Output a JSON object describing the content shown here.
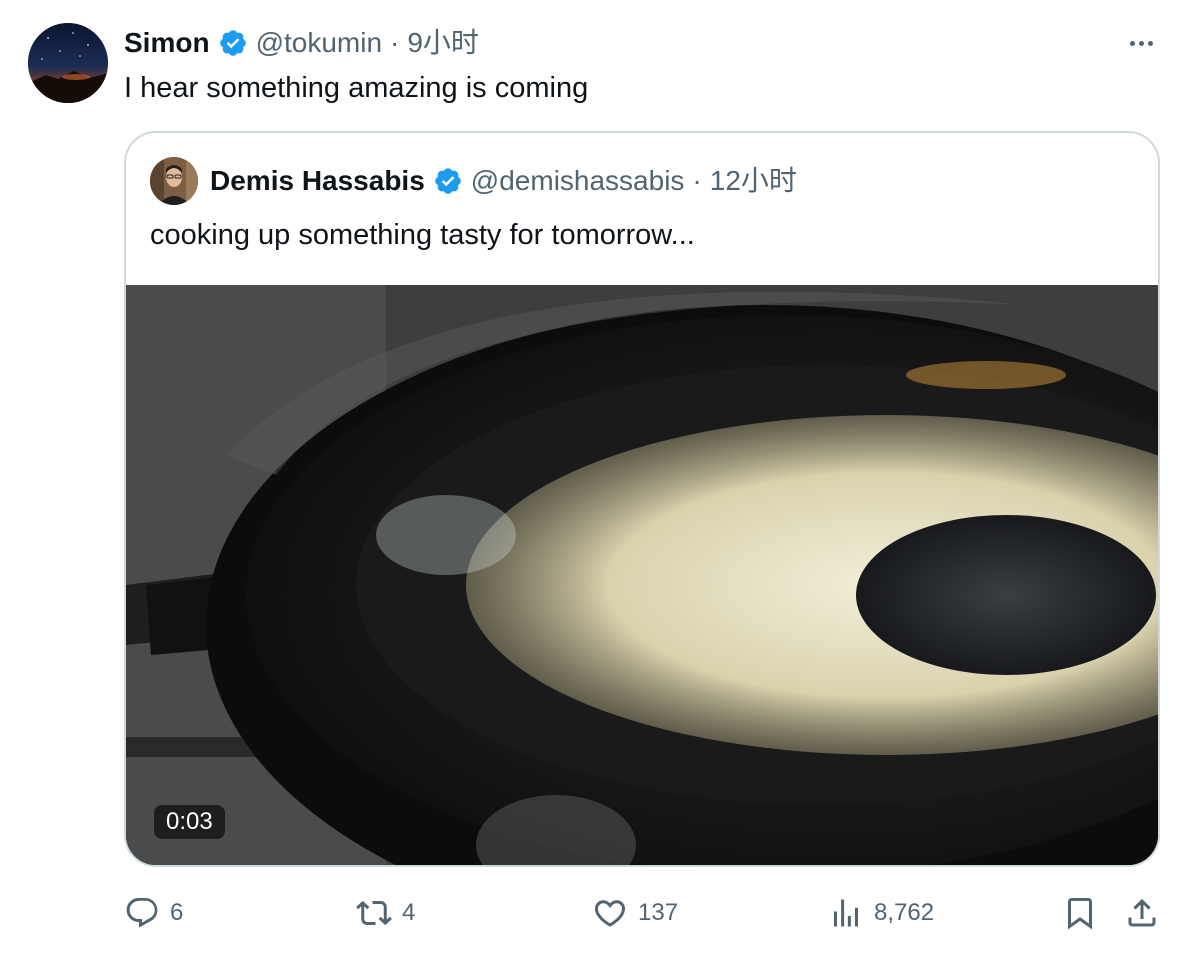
{
  "tweet": {
    "author_name": "Simon",
    "author_handle": "@tokumin",
    "separator": "·",
    "time": "9小时",
    "text": "I hear something amazing is coming"
  },
  "quoted": {
    "author_name": "Demis Hassabis",
    "author_handle": "@demishassabis",
    "separator": "·",
    "time": "12小时",
    "text": "cooking up something tasty for tomorrow...",
    "video_duration": "0:03"
  },
  "actions": {
    "replies": "6",
    "retweets": "4",
    "likes": "137",
    "views": "8,762"
  },
  "colors": {
    "text_primary": "#0f1419",
    "text_secondary": "#536471",
    "verified_badge": "#1d9bf0",
    "card_border": "#cfd9de"
  },
  "icons": {
    "verified": "verified-badge-icon",
    "more": "more-horizontal-icon",
    "reply": "reply-icon",
    "retweet": "retweet-icon",
    "like": "heart-icon",
    "views": "views-chart-icon",
    "bookmark": "bookmark-icon",
    "share": "share-icon"
  }
}
